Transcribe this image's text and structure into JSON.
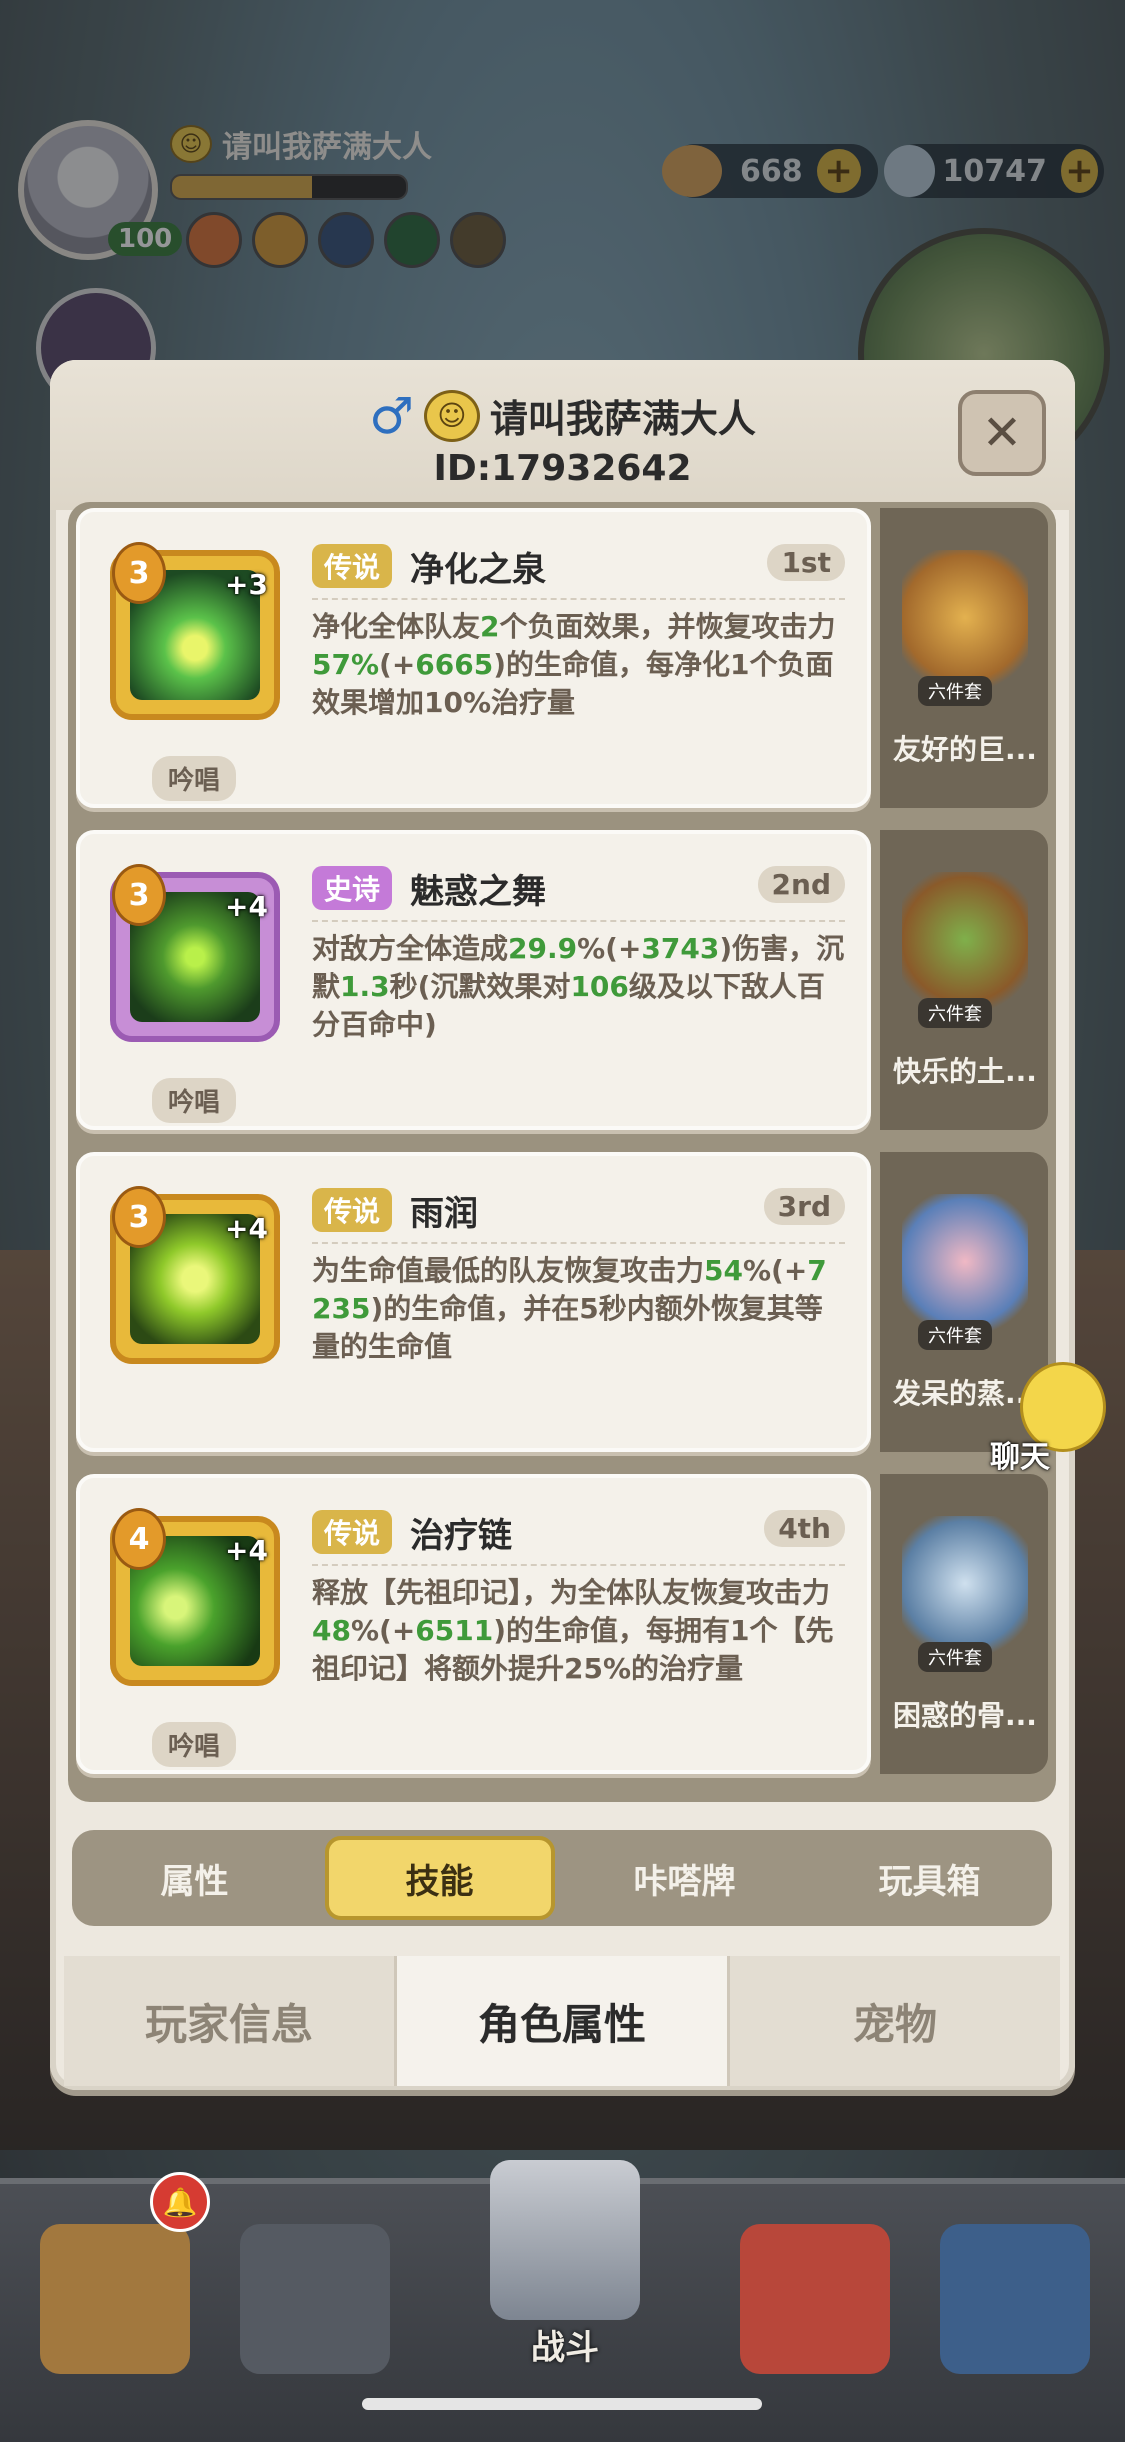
{
  "hud": {
    "player_name": "请叫我萨满大人",
    "level": "100",
    "exp_fraction": 0.6,
    "currency_1": "668",
    "currency_2": "10747"
  },
  "panel": {
    "player_name": "请叫我萨满大人",
    "player_id": "ID:17932642",
    "close_label": "✕"
  },
  "skills": [
    {
      "level": "3",
      "plus": "+3",
      "rarity": "传说",
      "name": "净化之泉",
      "rank": "1st",
      "desc_parts": [
        "净化全体队友",
        "2",
        "个负面效果，并恢复攻击力",
        "57%",
        "(+",
        "6665",
        ")的生命值，每净化1个负面效果增加10%治疗量"
      ],
      "type_tag": "吟唱",
      "side_name": "友好的巨...",
      "set": "六件套"
    },
    {
      "level": "3",
      "plus": "+4",
      "rarity": "史诗",
      "name": "魅惑之舞",
      "rank": "2nd",
      "desc_parts": [
        "对敌方全体造成",
        "29.9",
        "%(+",
        "3743",
        ")伤害，沉默",
        "1.3",
        "秒(沉默效果对",
        "106",
        "级及以下敌人百分百命中)"
      ],
      "type_tag": "吟唱",
      "side_name": "快乐的土...",
      "set": "六件套"
    },
    {
      "level": "3",
      "plus": "+4",
      "rarity": "传说",
      "name": "雨润",
      "rank": "3rd",
      "desc_parts": [
        "为生命值最低的队友恢复攻击力",
        "54",
        "%(+",
        "7235",
        ")的生命值，并在5秒内额外恢复其等量的生命值"
      ],
      "type_tag": "",
      "side_name": "发呆的蒸...",
      "set": "六件套"
    },
    {
      "level": "4",
      "plus": "+4",
      "rarity": "传说",
      "name": "治疗链",
      "rank": "4th",
      "desc_parts": [
        "释放【先祖印记】，为全体队友恢复攻击力",
        "48",
        "%(+",
        "6511",
        ")的生命值，每拥有1个【先祖印记】将额外提升25%的治疗量"
      ],
      "type_tag": "吟唱",
      "side_name": "困惑的骨...",
      "set": "六件套"
    }
  ],
  "subtabs": [
    "属性",
    "技能",
    "咔嗒牌",
    "玩具箱"
  ],
  "bottomtabs": [
    "玩家信息",
    "角色属性",
    "宠物"
  ],
  "chat_label": "聊天",
  "nav": {
    "battle_label": "战斗"
  },
  "colors": {
    "legend": "#d9b54a",
    "epic": "#c47ad8",
    "green_value": "#3f9a3a",
    "active_tab": "#f2d66b"
  }
}
